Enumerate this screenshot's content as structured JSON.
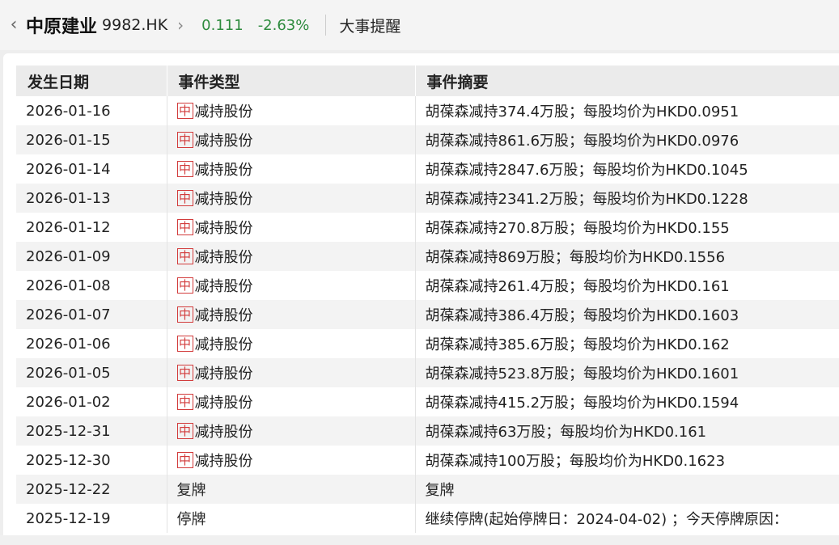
{
  "header": {
    "back_icon": "chevron-left-icon",
    "stock_name": "中原建业",
    "stock_code": "9982.HK",
    "forward_icon": "chevron-right-icon",
    "price": "0.111",
    "change": "-2.63%",
    "section_title": "大事提醒",
    "price_color": "#2e8b3e"
  },
  "table": {
    "columns": [
      "发生日期",
      "事件类型",
      "事件摘要"
    ],
    "badge_color": "#d23b3b",
    "rows": [
      {
        "date": "2026-01-16",
        "badge": "中",
        "type": "减持股份",
        "summary": "胡葆森减持374.4万股；每股均价为HKD0.0951"
      },
      {
        "date": "2026-01-15",
        "badge": "中",
        "type": "减持股份",
        "summary": "胡葆森减持861.6万股；每股均价为HKD0.0976"
      },
      {
        "date": "2026-01-14",
        "badge": "中",
        "type": "减持股份",
        "summary": "胡葆森减持2847.6万股；每股均价为HKD0.1045"
      },
      {
        "date": "2026-01-13",
        "badge": "中",
        "type": "减持股份",
        "summary": "胡葆森减持2341.2万股；每股均价为HKD0.1228"
      },
      {
        "date": "2026-01-12",
        "badge": "中",
        "type": "减持股份",
        "summary": "胡葆森减持270.8万股；每股均价为HKD0.155"
      },
      {
        "date": "2026-01-09",
        "badge": "中",
        "type": "减持股份",
        "summary": "胡葆森减持869万股；每股均价为HKD0.1556"
      },
      {
        "date": "2026-01-08",
        "badge": "中",
        "type": "减持股份",
        "summary": "胡葆森减持261.4万股；每股均价为HKD0.161"
      },
      {
        "date": "2026-01-07",
        "badge": "中",
        "type": "减持股份",
        "summary": "胡葆森减持386.4万股；每股均价为HKD0.1603"
      },
      {
        "date": "2026-01-06",
        "badge": "中",
        "type": "减持股份",
        "summary": "胡葆森减持385.6万股；每股均价为HKD0.162"
      },
      {
        "date": "2026-01-05",
        "badge": "中",
        "type": "减持股份",
        "summary": "胡葆森减持523.8万股；每股均价为HKD0.1601"
      },
      {
        "date": "2026-01-02",
        "badge": "中",
        "type": "减持股份",
        "summary": "胡葆森减持415.2万股；每股均价为HKD0.1594"
      },
      {
        "date": "2025-12-31",
        "badge": "中",
        "type": "减持股份",
        "summary": "胡葆森减持63万股；每股均价为HKD0.161"
      },
      {
        "date": "2025-12-30",
        "badge": "中",
        "type": "减持股份",
        "summary": "胡葆森减持100万股；每股均价为HKD0.1623"
      },
      {
        "date": "2025-12-22",
        "badge": "",
        "type": "复牌",
        "summary": "复牌"
      },
      {
        "date": "2025-12-19",
        "badge": "",
        "type": "停牌",
        "summary": "继续停牌(起始停牌日：2024-04-02) ；今天停牌原因："
      }
    ]
  }
}
